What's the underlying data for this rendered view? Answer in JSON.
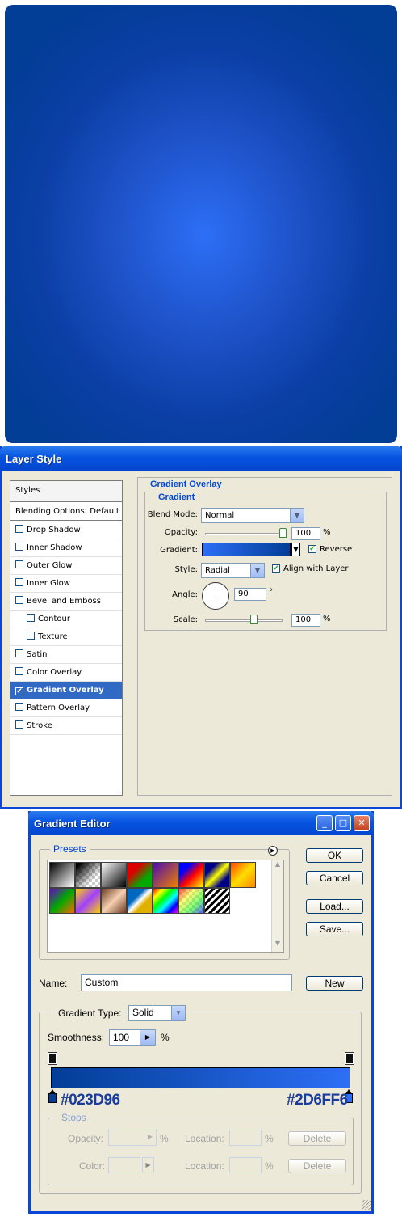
{
  "layer_style": {
    "title": "Layer Style",
    "styles_header": "Styles",
    "blending_options": "Blending Options: Default",
    "items": [
      {
        "label": "Drop Shadow",
        "checked": false,
        "indent": false
      },
      {
        "label": "Inner Shadow",
        "checked": false,
        "indent": false
      },
      {
        "label": "Outer Glow",
        "checked": false,
        "indent": false
      },
      {
        "label": "Inner Glow",
        "checked": false,
        "indent": false
      },
      {
        "label": "Bevel and Emboss",
        "checked": false,
        "indent": false
      },
      {
        "label": "Contour",
        "checked": false,
        "indent": true
      },
      {
        "label": "Texture",
        "checked": false,
        "indent": true
      },
      {
        "label": "Satin",
        "checked": false,
        "indent": false
      },
      {
        "label": "Color Overlay",
        "checked": false,
        "indent": false
      },
      {
        "label": "Gradient Overlay",
        "checked": true,
        "indent": false,
        "selected": true
      },
      {
        "label": "Pattern Overlay",
        "checked": false,
        "indent": false
      },
      {
        "label": "Stroke",
        "checked": false,
        "indent": false
      }
    ],
    "panel": {
      "title": "Gradient Overlay",
      "group": "Gradient",
      "blend_mode_label": "Blend Mode:",
      "blend_mode_value": "Normal",
      "opacity_label": "Opacity:",
      "opacity_value": "100",
      "opacity_unit": "%",
      "opacity_level": 1.0,
      "gradient_label": "Gradient:",
      "reverse_label": "Reverse",
      "reverse_checked": true,
      "style_label": "Style:",
      "style_value": "Radial",
      "align_label": "Align with Layer",
      "align_checked": true,
      "angle_label": "Angle:",
      "angle_value": "90",
      "angle_unit": "°",
      "scale_label": "Scale:",
      "scale_value": "100",
      "scale_unit": "%",
      "scale_level": 0.625
    }
  },
  "gradient_editor": {
    "title": "Gradient Editor",
    "presets_label": "Presets",
    "buttons": {
      "ok": "OK",
      "cancel": "Cancel",
      "load": "Load...",
      "save": "Save...",
      "new": "New",
      "delete1": "Delete",
      "delete2": "Delete"
    },
    "name_label": "Name:",
    "name_value": "Custom",
    "gradient_type_label": "Gradient Type:",
    "gradient_type_value": "Solid",
    "smoothness_label": "Smoothness:",
    "smoothness_value": "100",
    "smoothness_unit": "%",
    "stops_label": "Stops",
    "opacity_label": "Opacity:",
    "color_label": "Color:",
    "location_label": "Location:",
    "location_label2": "Location:",
    "pct": "%",
    "pct2": "%",
    "pct3": "%",
    "left_color": "#023D96",
    "right_color": "#2D6FF6"
  },
  "colors": {
    "canvas_dark": "#023d96",
    "canvas_light": "#2d6ff6",
    "xp_title_blue": "#0654e0",
    "dialog_bg": "#ece9d8",
    "selection": "#316ac5"
  }
}
